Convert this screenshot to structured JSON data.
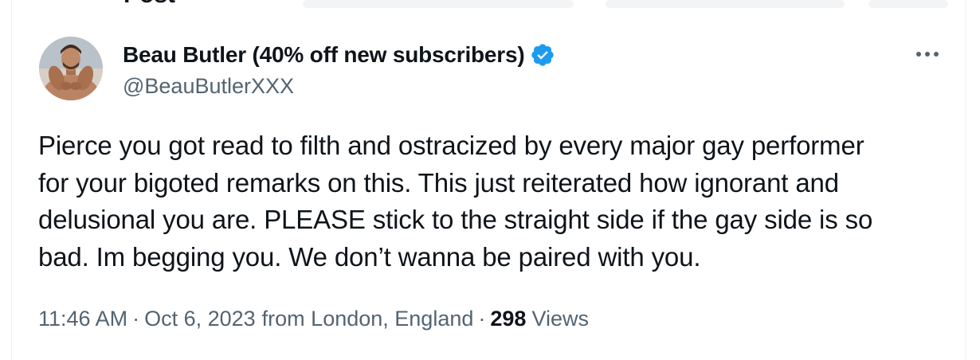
{
  "header": {
    "title": "Post"
  },
  "author": {
    "display_name": "Beau Butler (40% off new subscribers)",
    "handle": "@BeauButlerXXX",
    "verified_icon": "verified-badge-icon",
    "verified_color": "#1d9bf0"
  },
  "tweet": {
    "lines": [
      "Pierce you got read to filth and ostracized by every major gay performer",
      "for your bigoted remarks on this. This just reiterated how ignorant and",
      "delusional you are. PLEASE stick to the straight side if the gay side is so",
      "bad. Im begging you. We don’t wanna be paired with you."
    ]
  },
  "meta": {
    "time": "11:46 AM",
    "separator": "·",
    "date": "Oct 6, 2023",
    "location": "from London, England",
    "views_count": "298",
    "views_label": "Views"
  },
  "menu": {
    "icon": "more-horizontal-icon"
  },
  "colors": {
    "text_primary": "#0f1419",
    "text_secondary": "#536471",
    "accent": "#1d9bf0",
    "border": "#eff3f4"
  }
}
